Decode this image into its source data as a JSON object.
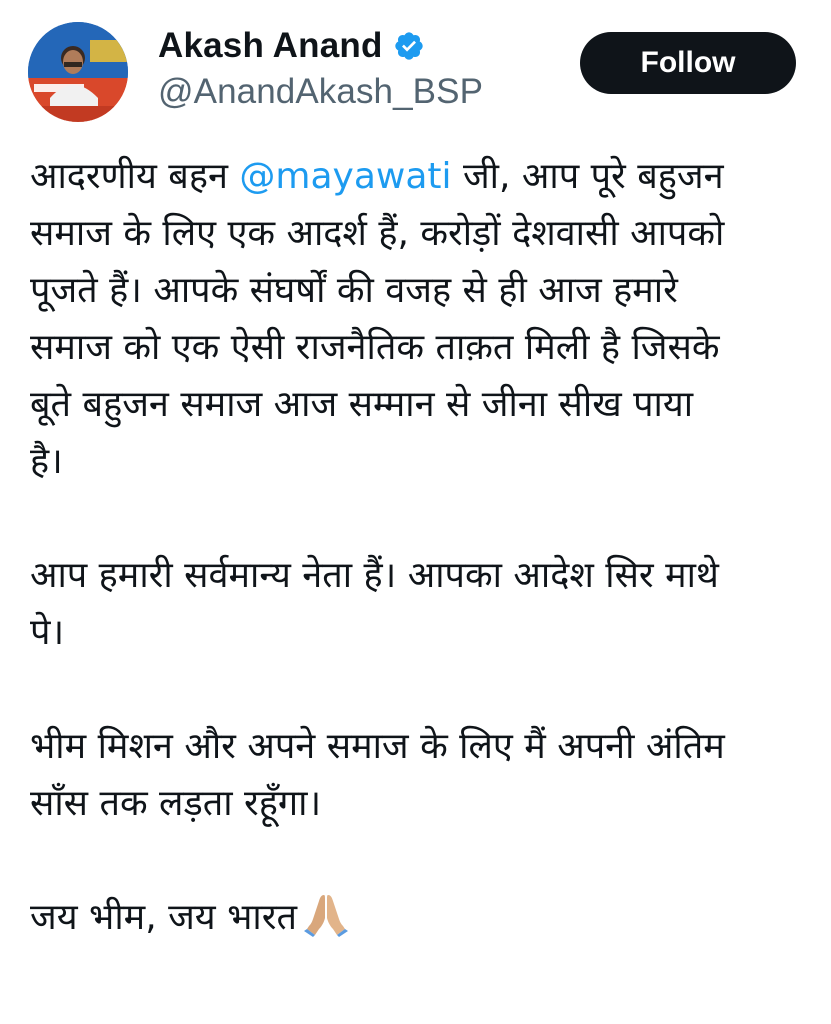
{
  "profile": {
    "display_name": "Akash Anand",
    "handle": "@AnandAkash_BSP",
    "verified": true,
    "verified_color": "#1d9bf0",
    "avatar_icon": "profile-photo"
  },
  "actions": {
    "follow_label": "Follow"
  },
  "tweet": {
    "lines": [
      {
        "pre": "आदरणीय बहन ",
        "mention": "@mayawati",
        "post": " जी, आप पूरे बहुजन"
      },
      {
        "text": "समाज के लिए एक आदर्श हैं, करोड़ों देशवासी आपको"
      },
      {
        "text": "पूजते हैं। आपके संघर्षों की वजह से ही आज हमारे"
      },
      {
        "text": "समाज को एक ऐसी राजनैतिक ताक़त मिली है जिसके"
      },
      {
        "text": "बूते बहुजन समाज आज सम्मान से जीना सीख पाया"
      },
      {
        "text": "है।"
      },
      {
        "text": ""
      },
      {
        "text": "आप हमारी सर्वमान्य नेता हैं। आपका आदेश सिर माथे"
      },
      {
        "text": "पे।"
      },
      {
        "text": ""
      },
      {
        "text": "भीम मिशन और अपने समाज के लिए मैं अपनी अंतिम"
      },
      {
        "text": "साँस तक लड़ता रहूँगा।"
      },
      {
        "text": ""
      },
      {
        "text": "जय भीम, जय भारत"
      }
    ],
    "emoji_icon": "folded-hands-emoji",
    "colors": {
      "text": "#0f1419",
      "mention": "#1d9bf0",
      "secondary": "#536471"
    }
  }
}
